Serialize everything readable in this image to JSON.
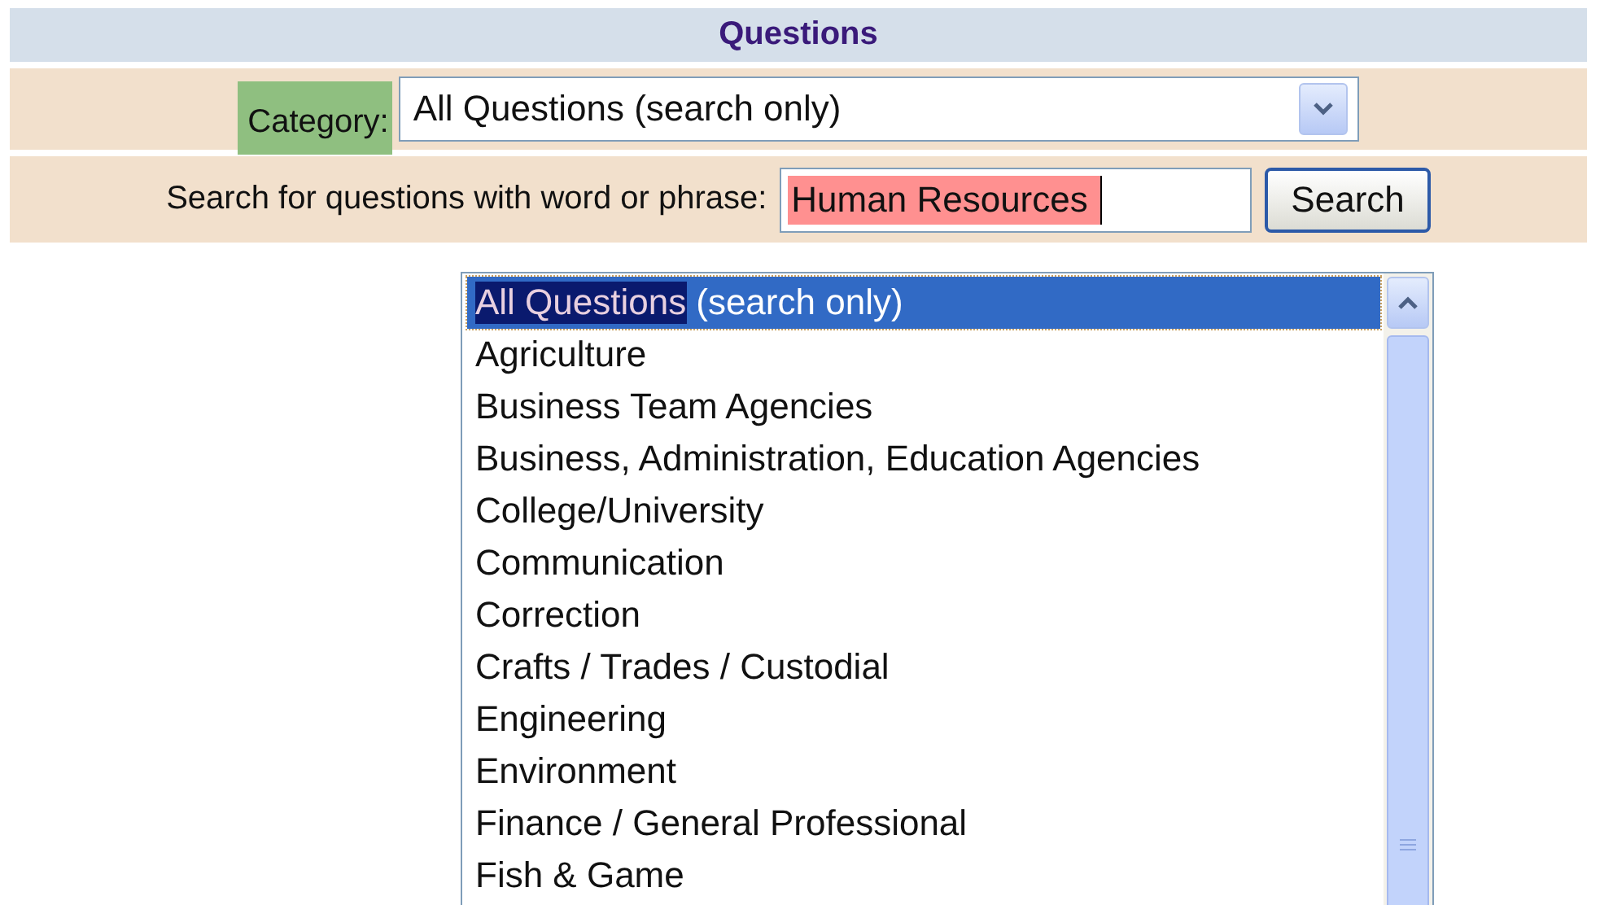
{
  "header": {
    "title": "Questions"
  },
  "category": {
    "label": "Category:",
    "value": "All Questions (search only)",
    "expanded": true
  },
  "search": {
    "label": "Search for questions with word or phrase:",
    "value": "Human Resources",
    "button": "Search"
  },
  "dropdown_options": [
    {
      "highlight": "All Questions",
      "label": "(search only)",
      "selected": true
    },
    {
      "label": "Agriculture",
      "selected": false
    },
    {
      "label": "Business Team Agencies",
      "selected": false
    },
    {
      "label": "Business, Administration, Education Agencies",
      "selected": false
    },
    {
      "label": "College/University",
      "selected": false
    },
    {
      "label": "Communication",
      "selected": false
    },
    {
      "label": "Correction",
      "selected": false
    },
    {
      "label": "Crafts / Trades / Custodial",
      "selected": false
    },
    {
      "label": "Engineering",
      "selected": false
    },
    {
      "label": "Environment",
      "selected": false
    },
    {
      "label": "Finance / General Professional",
      "selected": false
    },
    {
      "label": "Fish & Game",
      "selected": false
    }
  ]
}
